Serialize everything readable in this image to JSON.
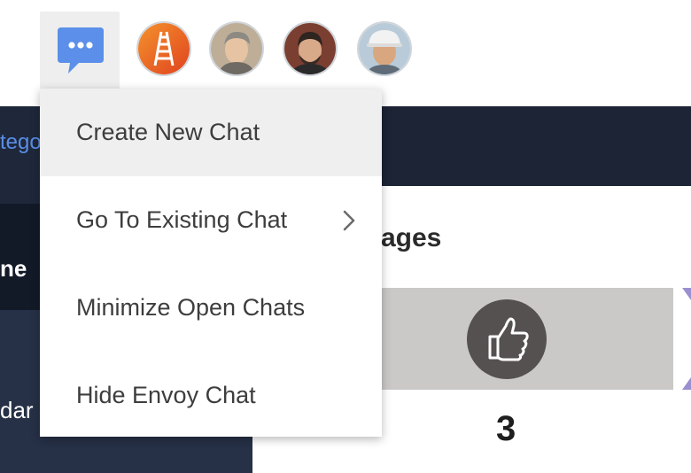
{
  "header": {
    "chat_button_icon": "chat-bubble-icon",
    "avatars": [
      {
        "icon": "ladder-logo-icon",
        "bg": "#f06a28"
      },
      {
        "icon": "person-photo-icon"
      },
      {
        "icon": "person-photo-icon"
      },
      {
        "icon": "person-hardhat-photo-icon"
      }
    ]
  },
  "background": {
    "left_link_partial": "tego",
    "left_label_1": "ne",
    "left_label_2": "dar",
    "section_title_partial": "tages",
    "stage_icon": "thumbs-up-icon",
    "stage_count": "3"
  },
  "menu": {
    "items": [
      {
        "label": "Create New Chat",
        "highlighted": true
      },
      {
        "label": "Go To Existing Chat",
        "has_submenu": true
      },
      {
        "label": "Minimize Open Chats"
      },
      {
        "label": "Hide Envoy Chat"
      }
    ]
  },
  "colors": {
    "accent_blue": "#5b8fea",
    "menu_highlight": "#efefef",
    "dark_panel": "#1b2333"
  }
}
